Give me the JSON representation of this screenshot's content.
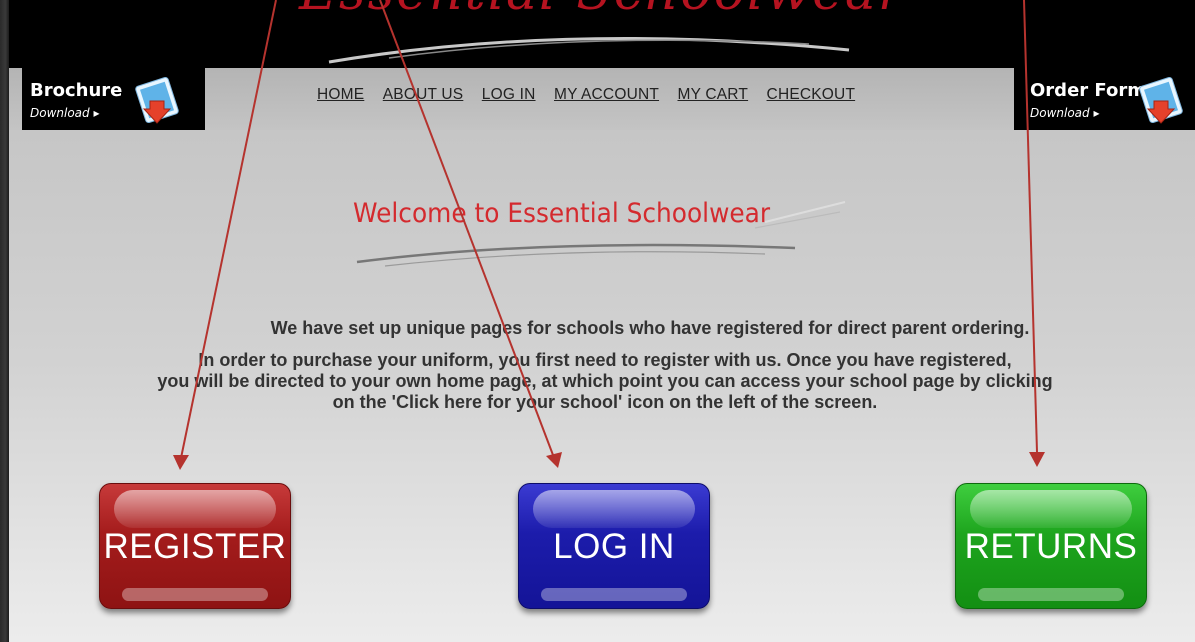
{
  "header": {
    "logo_text": "Essential Schoolwear"
  },
  "brochure": {
    "title": "Brochure",
    "subtitle": "Download ▸"
  },
  "order_form": {
    "title": "Order Form",
    "subtitle": "Download ▸"
  },
  "nav": {
    "items": [
      "HOME",
      "ABOUT US",
      "LOG IN",
      "MY ACCOUNT",
      "MY CART",
      "CHECKOUT"
    ]
  },
  "welcome": {
    "title": "Welcome to Essential Schoolwear"
  },
  "intro": {
    "line1": "We have set up unique pages for schools who have registered for direct parent ordering.",
    "line2": "In order to purchase your uniform, you first need to register with us. Once you have registered,",
    "line3": "you will be directed to your own home page, at which point you can access your school page by clicking",
    "line4": "on the 'Click here for your school' icon on the left of the screen."
  },
  "buttons": {
    "register": "REGISTER",
    "login": "LOG IN",
    "returns": "RETURNS"
  },
  "colors": {
    "brand_red": "#d42a2e",
    "register": "#a41c1c",
    "login": "#1c1cab",
    "returns": "#1ea51e",
    "annotation_arrow": "#b5332e"
  }
}
